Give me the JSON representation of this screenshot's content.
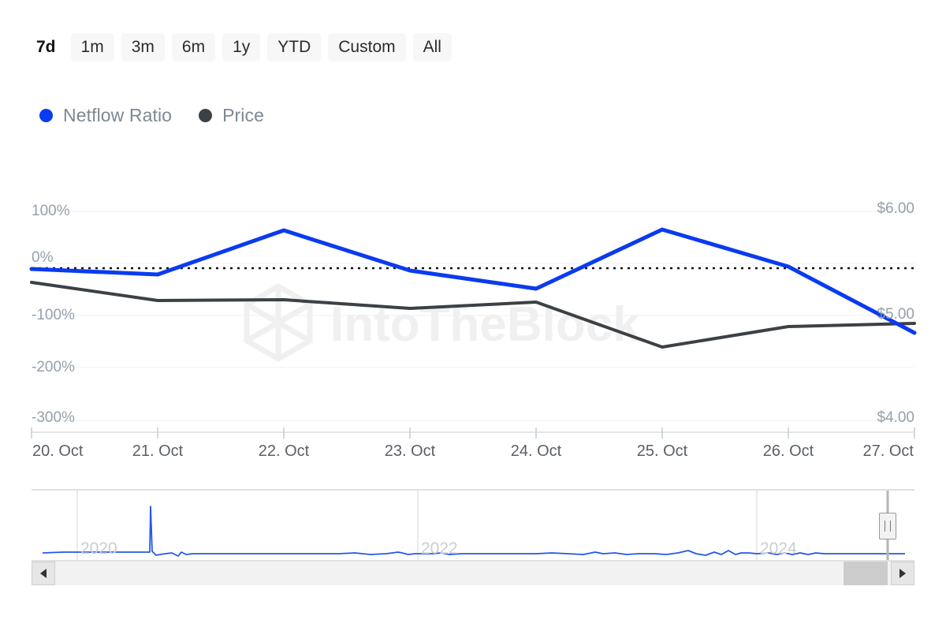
{
  "range_selector": {
    "buttons": [
      {
        "label": "7d",
        "selected": true
      },
      {
        "label": "1m",
        "selected": false
      },
      {
        "label": "3m",
        "selected": false
      },
      {
        "label": "6m",
        "selected": false
      },
      {
        "label": "1y",
        "selected": false
      },
      {
        "label": "YTD",
        "selected": false
      },
      {
        "label": "Custom",
        "selected": false
      },
      {
        "label": "All",
        "selected": false
      }
    ]
  },
  "legend": {
    "items": [
      {
        "label": "Netflow Ratio",
        "color": "#0a3bf0",
        "marker": "legend-dot-icon"
      },
      {
        "label": "Price",
        "color": "#3c4145",
        "marker": "legend-dot-icon"
      }
    ]
  },
  "watermark": {
    "text": "IntoTheBlock",
    "logo": "hexagon-logo-icon"
  },
  "navigator": {
    "year_labels": [
      "2020",
      "2022",
      "2024"
    ],
    "series_color": "#2457e8",
    "handle": "navigator-right-handle",
    "scrollbar": {
      "left_arrow": "arrow-left-icon",
      "right_arrow": "arrow-right-icon"
    }
  },
  "chart_data": {
    "type": "line",
    "title": "",
    "xlabel": "",
    "grid": true,
    "legend_position": "top-left",
    "x": [
      "20. Oct",
      "21. Oct",
      "22. Oct",
      "23. Oct",
      "24. Oct",
      "25. Oct",
      "26. Oct",
      "27. Oct"
    ],
    "xtick_labels": [
      "20. Oct",
      "21. Oct",
      "22. Oct",
      "23. Oct",
      "24. Oct",
      "25. Oct",
      "26. Oct",
      "27. Oct"
    ],
    "axes": [
      {
        "id": "left",
        "ylabel": "",
        "ylim": [
          -300,
          100
        ],
        "ytick_labels": [
          "100%",
          "0%",
          "-100%",
          "-200%",
          "-300%"
        ],
        "ytick_values": [
          100,
          0,
          -100,
          -200,
          -300
        ]
      },
      {
        "id": "right",
        "ylabel": "",
        "ylim": [
          4.0,
          6.0
        ],
        "ytick_labels": [
          "$6.00",
          "$5.00",
          "$4.00"
        ],
        "ytick_values": [
          6.0,
          5.0,
          4.0
        ]
      }
    ],
    "zero_line": 0,
    "series": [
      {
        "name": "Netflow Ratio",
        "axis": "left",
        "color": "#0a3bf0",
        "unit": "%",
        "values": [
          -10,
          -20,
          64,
          -14,
          -48,
          65,
          -6,
          -133
        ]
      },
      {
        "name": "Price",
        "axis": "right",
        "color": "#3c4145",
        "unit": "$",
        "values": [
          5.31,
          5.14,
          5.15,
          5.07,
          5.06,
          4.66,
          4.88,
          4.92
        ]
      }
    ]
  }
}
